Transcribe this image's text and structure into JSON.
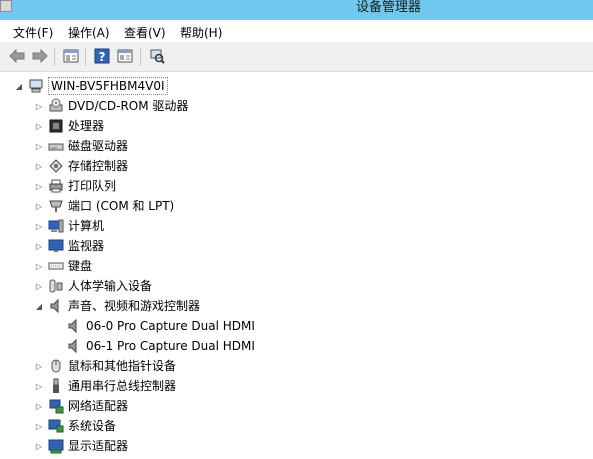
{
  "window": {
    "title": "设备管理器"
  },
  "menu": [
    "文件(F)",
    "操作(A)",
    "查看(V)",
    "帮助(H)"
  ],
  "toolbar": {
    "icons": [
      "back-arrow-icon",
      "forward-arrow-icon",
      "properties-icon",
      "help-icon",
      "view-icon",
      "scan-hardware-icon"
    ]
  },
  "tree": {
    "root": {
      "label": "WIN-BV5FHBM4V0I",
      "expanded": true
    },
    "categories": [
      {
        "label": "DVD/CD-ROM 驱动器",
        "icon": "dvd-drive-icon",
        "expanded": false
      },
      {
        "label": "处理器",
        "icon": "processor-icon",
        "expanded": false
      },
      {
        "label": "磁盘驱动器",
        "icon": "disk-drive-icon",
        "expanded": false
      },
      {
        "label": "存储控制器",
        "icon": "storage-controller-icon",
        "expanded": false
      },
      {
        "label": "打印队列",
        "icon": "printer-icon",
        "expanded": false
      },
      {
        "label": "端口 (COM 和 LPT)",
        "icon": "port-icon",
        "expanded": false
      },
      {
        "label": "计算机",
        "icon": "computer-icon",
        "expanded": false
      },
      {
        "label": "监视器",
        "icon": "monitor-icon",
        "expanded": false
      },
      {
        "label": "键盘",
        "icon": "keyboard-icon",
        "expanded": false
      },
      {
        "label": "人体学输入设备",
        "icon": "hid-icon",
        "expanded": false
      },
      {
        "label": "声音、视频和游戏控制器",
        "icon": "speaker-icon",
        "expanded": true,
        "children": [
          {
            "label": "06-0 Pro Capture Dual HDMI",
            "icon": "speaker-icon"
          },
          {
            "label": "06-1 Pro Capture Dual HDMI",
            "icon": "speaker-icon"
          }
        ]
      },
      {
        "label": "鼠标和其他指针设备",
        "icon": "mouse-icon",
        "expanded": false
      },
      {
        "label": "通用串行总线控制器",
        "icon": "usb-icon",
        "expanded": false
      },
      {
        "label": "网络适配器",
        "icon": "network-adapter-icon",
        "expanded": false
      },
      {
        "label": "系统设备",
        "icon": "system-device-icon",
        "expanded": false
      },
      {
        "label": "显示适配器",
        "icon": "display-adapter-icon",
        "expanded": false
      }
    ]
  }
}
